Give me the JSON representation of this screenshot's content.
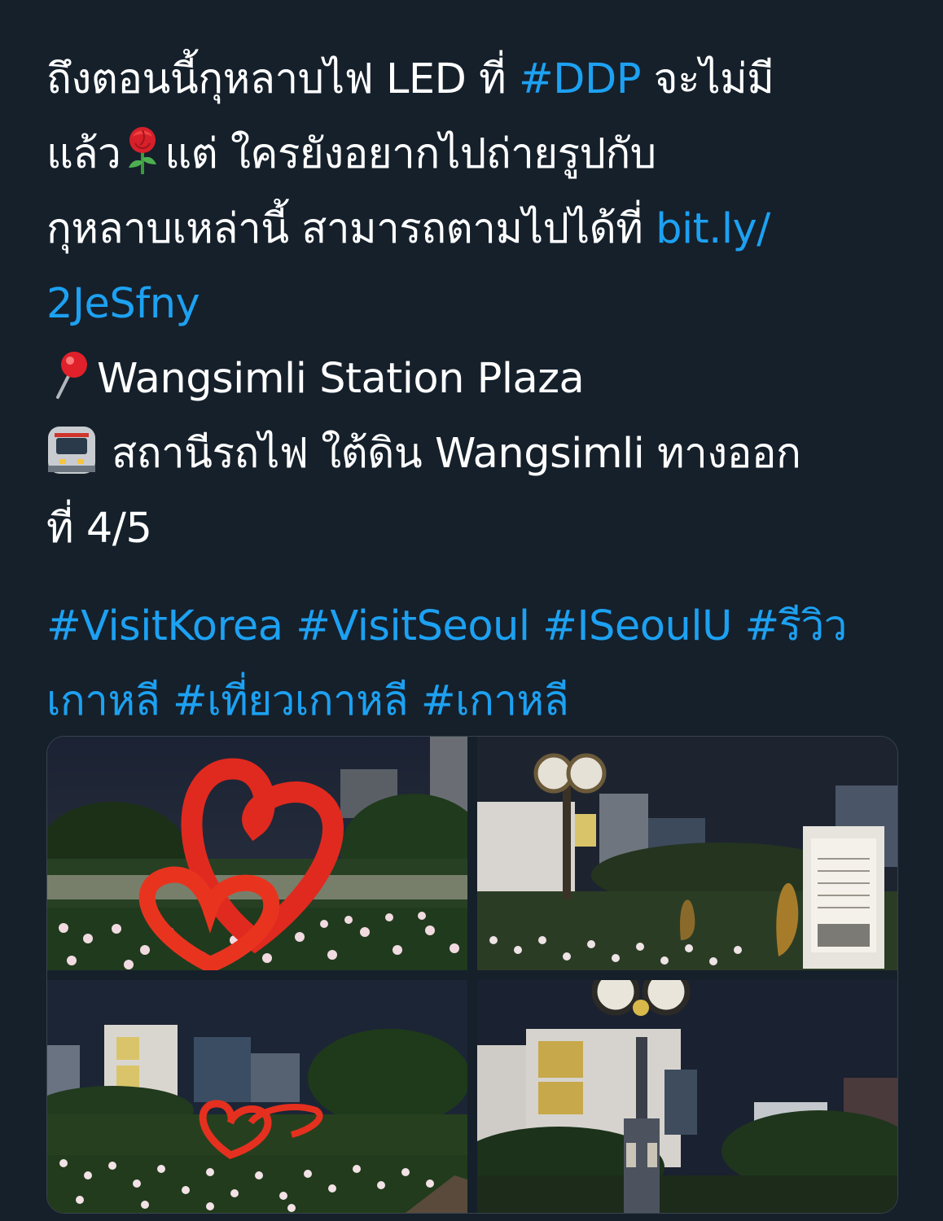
{
  "tweet": {
    "line1_prefix": "ถึงตอนนี้กุหลาบไฟ LED ที่ ",
    "hashtag_ddp": "#DDP",
    "line1_suffix": " จะไม่มี",
    "line2_prefix": "แล้ว",
    "rose_icon": "rose-emoji",
    "line2_suffix": "แต่ ใครยังอยากไปถ่ายรูปกับ",
    "line3_text": "กุหลาบเหล่านี้ สามารถตามไปได้ที่ ",
    "link_part1": "bit.ly/",
    "link_part2": "2JeSfny",
    "pin_icon": "round-pushpin-emoji",
    "location_text": "Wangsimli Station Plaza",
    "train_icon": "metro-emoji",
    "station_text": "สถานีรถไฟ ใต้ดิน Wangsimli ทางออก",
    "exit_text": "ที่ 4/5",
    "hashtags_line1": "#VisitKorea #VisitSeoul #ISeoulU #รีวิว",
    "hashtags_line2": "เกาหลี #เที่ยวเกาหลี #เกาหลี"
  },
  "media": {
    "count": 4,
    "photos": [
      {
        "subject": "red heart sculpture with LED roses"
      },
      {
        "subject": "clock tower, statues and memorial plaque"
      },
      {
        "subject": "red heart sculpture among LED rose field"
      },
      {
        "subject": "clock tower in front of building"
      }
    ]
  },
  "colors": {
    "background": "#15202b",
    "text": "#ffffff",
    "link": "#1da1f2"
  }
}
